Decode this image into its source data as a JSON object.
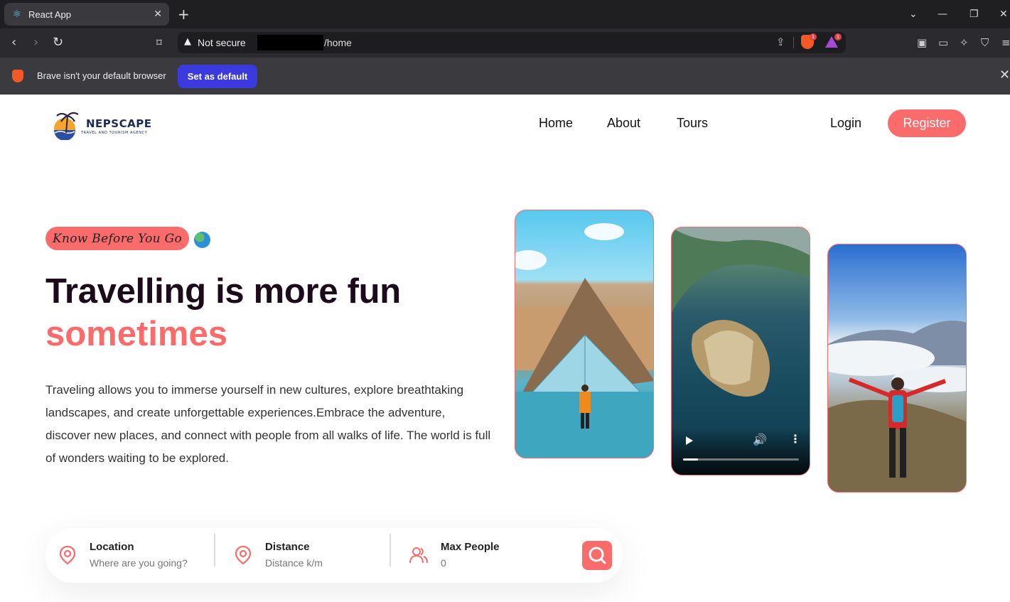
{
  "browser": {
    "tab_title": "React App",
    "tab_close": "✕",
    "new_tab": "+",
    "security_label": "Not secure",
    "url_path": "/home",
    "shield_badge": "1",
    "rewards_badge": "1",
    "infobar_message": "Brave isn't your default browser",
    "infobar_button": "Set as default",
    "infobar_close": "✕"
  },
  "header": {
    "logo_name": "NEPSCAPE",
    "logo_tagline": "TRAVEL AND TOURISM AGENCY",
    "nav": [
      "Home",
      "About",
      "Tours"
    ],
    "login": "Login",
    "register": "Register"
  },
  "hero": {
    "subtitle": "Know Before You Go",
    "title_line1": "Travelling is more fun",
    "title_line2": "sometimes",
    "description": "Traveling allows you to immerse yourself in new cultures, explore breathtaking landscapes, and create unforgettable experiences.Embrace the adventure, discover new places, and connect with people from all walks of life. The world is full of wonders waiting to be explored.",
    "video_progress": 0.13
  },
  "search": {
    "location_label": "Location",
    "location_placeholder": "Where are you going?",
    "distance_label": "Distance",
    "distance_placeholder": "Distance k/m",
    "people_label": "Max People",
    "people_placeholder": "0"
  },
  "colors": {
    "accent": "#fa6b6b",
    "heading": "#1c0b1a",
    "browser_dark": "#1f1f22",
    "set_default_button": "#3a3adf"
  }
}
